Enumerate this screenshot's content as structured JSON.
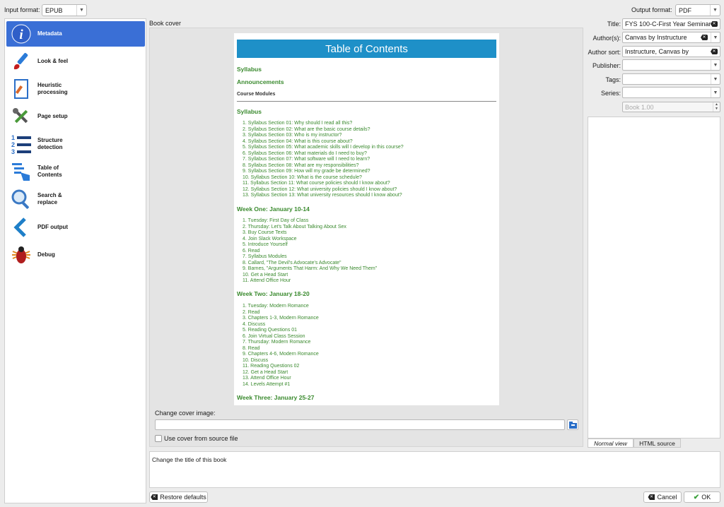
{
  "input_format": {
    "label": "Input format:",
    "value": "EPUB"
  },
  "output_format": {
    "label": "Output format:",
    "value": "PDF"
  },
  "sidebar": {
    "items": [
      {
        "label": "Metadata",
        "icon": "info-icon"
      },
      {
        "label": "Look & feel",
        "icon": "brush-icon"
      },
      {
        "label": "Heuristic processing",
        "icon": "document-icon"
      },
      {
        "label": "Page setup",
        "icon": "tools-icon"
      },
      {
        "label": "Structure detection",
        "icon": "list-numbers-icon"
      },
      {
        "label": "Table of Contents",
        "icon": "toc-icon"
      },
      {
        "label": "Search & replace",
        "icon": "magnifier-icon"
      },
      {
        "label": "PDF output",
        "icon": "chevron-left-icon"
      },
      {
        "label": "Debug",
        "icon": "bug-icon"
      }
    ]
  },
  "cover": {
    "section_label": "Book cover",
    "change_label": "Change cover image:",
    "path_value": "",
    "use_source_label": "Use cover from source file",
    "use_source_checked": false
  },
  "toc": {
    "title": "Table of Contents",
    "syllabus_link": "Syllabus",
    "announcements_link": "Announcements",
    "modules_header": "Course Modules",
    "sections": [
      {
        "heading": "Syllabus",
        "items": [
          "Syllabus Section 01: Why should I read all this?",
          "Syllabus Section 02: What are the basic course details?",
          "Syllabus Section 03: Who is my instructor?",
          "Syllabus Section 04: What is this course about?",
          "Syllabus Section 05: What academic skills will I develop in this course?",
          "Syllabus Section 06: What materials do I need to buy?",
          "Syllabus Section 07: What software will I need to learn?",
          "Syllabus Section 08: What are my responsibilities?",
          "Syllabus Section 09: How will my grade be determined?",
          "Syllabus Section 10: What is the course schedule?",
          "Syllabus Section 11: What course policies should I know about?",
          "Syllabus Section 12: What university policies should I know about?",
          "Syllabus Section 13: What university resources should I know about?"
        ]
      },
      {
        "heading": "Week One: January 10-14",
        "items": [
          "Tuesday: First Day of Class",
          "Thursday: Let's Talk About Talking About Sex",
          "Buy Course Texts",
          "Join Slack Workspace",
          "Introduce Yourself",
          "Read",
          "Syllabus Modules",
          "Callard, \"The Devil's Advocate's Advocate\"",
          "Barnes, \"Arguments That Harm: And Why We Need Them\"",
          "Get a Head Start",
          "Attend Office Hour"
        ]
      },
      {
        "heading": "Week Two: January 18-20",
        "items": [
          "Tuesday: Modern Romance",
          "Read",
          "Chapters 1-3, Modern Romance",
          "Discuss",
          "Reading Questions 01",
          "Join Virtual Class Session",
          "Thursday: Modern Romance",
          "Read",
          "Chapters 4-6, Modern Romance",
          "Discuss",
          "Reading Questions 02",
          "Get a Head Start",
          "Attend Office Hour",
          "Levels Attempt #1"
        ]
      },
      {
        "heading": "Week Three: January 25-27",
        "items": []
      }
    ]
  },
  "metadata": {
    "title_label": "Title:",
    "title_value": "FYS 100-C-First Year Seminar",
    "authors_label": "Author(s):",
    "authors_value": "Canvas by Instructure",
    "author_sort_label": "Author sort:",
    "author_sort_value": "Instructure, Canvas by",
    "publisher_label": "Publisher:",
    "publisher_value": "",
    "tags_label": "Tags:",
    "tags_value": "",
    "series_label": "Series:",
    "series_value": "",
    "series_index_value": "Book 1.00"
  },
  "comments": {
    "normal_tab": "Normal view",
    "html_tab": "HTML source"
  },
  "help_text": "Change the title of this book",
  "buttons": {
    "restore": "Restore defaults",
    "cancel": "Cancel",
    "ok": "OK"
  },
  "colors": {
    "accent": "#3a6fd6",
    "toc_banner": "#1e90c8",
    "toc_link": "#3a8a2e"
  }
}
